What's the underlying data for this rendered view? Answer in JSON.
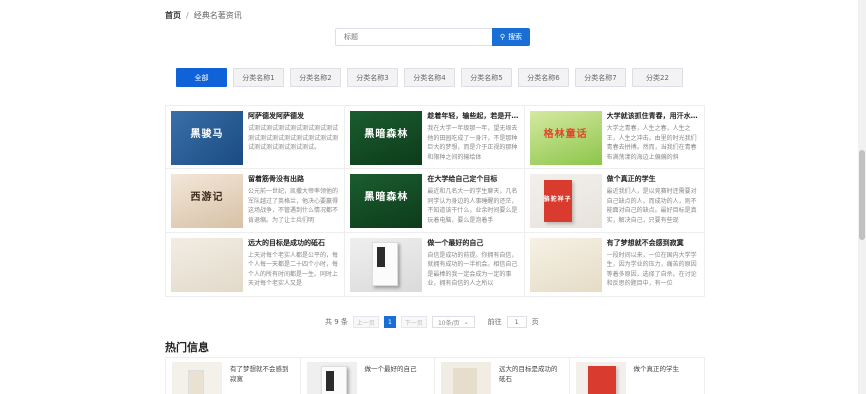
{
  "breadcrumb": {
    "home": "首页",
    "separator": "/",
    "current": "经典名著资讯"
  },
  "search": {
    "placeholder": "标题",
    "button_label": "搜索"
  },
  "categories": [
    {
      "label": "全部",
      "active": true
    },
    {
      "label": "分类名称1"
    },
    {
      "label": "分类名称2"
    },
    {
      "label": "分类名称3"
    },
    {
      "label": "分类名称4"
    },
    {
      "label": "分类名称5"
    },
    {
      "label": "分类名称6"
    },
    {
      "label": "分类名称7"
    },
    {
      "label": "分类22"
    }
  ],
  "articles": [
    {
      "title": "阿萨德发阿萨德发",
      "desc": "试测试测试测试测试测试测试测试测试测试测试测试测试测试测试测试测试测试测试测试测试。",
      "cover_text": "黑骏马"
    },
    {
      "title": "趁着年轻，输些起，若是开…",
      "desc": "我在大学一年级那一年，望无垠去他的田园吃成了一身汗，不是那种巨大的梦想，而是介于正视的那种和限种之间的输给体",
      "cover_text": "黑暗森林"
    },
    {
      "title": "大学就该抓住青春，用汗水…",
      "desc": "大学之青春，人生之春，人生之王，人生之冲击。由里的时光我们青春去拼搏。然而，当我们在青春布满荡漾的海边上偏偏的斜",
      "cover_text": "格林童话"
    },
    {
      "title": "留着筋骨没有出路",
      "desc": "公元前一世纪，凯撒大帝率领他的军队越过了英格兰，他决心要赢得这场战争，不管遇到什么情况都不肯退缩。为了让士兵们明",
      "cover_text": "西游记"
    },
    {
      "title": "在大学给自己定个目标",
      "desc": "最近和几名大一的学生聊天，几名同学认为身边的人事睡醒的还茫，不知道该干什么，业余时间要么是玩着电脑，要么是泡着手",
      "cover_text": "黑暗森林"
    },
    {
      "title": "做个真正的学生",
      "desc": "最近我们人，是以竞赛时还需要对自己缺点的人，而成功的人，则不能面对自己的缺点。最好目标是真实，解决自己，只要有些现",
      "cover_text": "骆驼祥子"
    },
    {
      "title": "远大的目标是成功的砥石",
      "desc": "上天对每个老实人都是公平的，每个人每一天都是二十四个小时，每个人的所有时间都是一生。同时上天对每个老实人又是",
      "cover_text": ""
    },
    {
      "title": "做一个最好的自己",
      "desc": "自信是成功的前提。你拥有自信，就拥有成功的一半机会。相信自己是最棒的我一定会成为一定的事业，拥有自信的人之所以",
      "cover_text": ""
    },
    {
      "title": "有了梦想就不会感到寂寞",
      "desc": "一段时间以来，一位在国内大学学生，因为学业的压力，痛苦的原因等着多原因，选择了自杀。在讨论和反思的题目中，有一位",
      "cover_text": ""
    }
  ],
  "pagination": {
    "total": "共 9 条",
    "prev": "上一页",
    "current_page": "1",
    "next": "下一页",
    "page_size": "10条/页",
    "goto_label": "前往",
    "goto_value": "1",
    "page_suffix": "页"
  },
  "hot": {
    "title": "热门信息",
    "items": [
      {
        "title": "有了梦想就不会感到寂寞"
      },
      {
        "title": "做一个最好的自己"
      },
      {
        "title": "远大的目标是成功的砥石"
      },
      {
        "title": "做个真正的学生"
      }
    ]
  }
}
